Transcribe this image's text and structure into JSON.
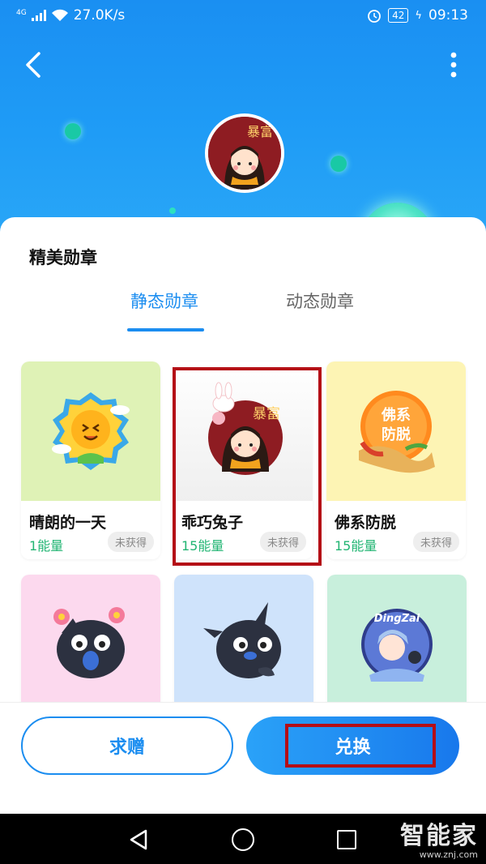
{
  "status_bar": {
    "network": "4G",
    "speed": "27.0K/s",
    "battery": "42",
    "time": "09:13"
  },
  "page": {
    "section_title": "精美勋章",
    "tabs": [
      {
        "label": "静态勋章",
        "active": true
      },
      {
        "label": "动态勋章",
        "active": false
      }
    ]
  },
  "medals": [
    {
      "name": "晴朗的一天",
      "energy": "1能量",
      "status": "未获得",
      "icon": "sunflower-badge-icon",
      "bg": "#dff2b6"
    },
    {
      "name": "乖巧兔子",
      "energy": "15能量",
      "status": "未获得",
      "icon": "rabbit-girl-badge-icon",
      "bg": "#f4f4f4"
    },
    {
      "name": "佛系防脱",
      "energy": "15能量",
      "status": "未获得",
      "icon": "ginger-badge-icon",
      "bg": "#fdf4b4"
    },
    {
      "name": "",
      "energy": "",
      "status": "",
      "icon": "crow-flowers-badge-icon",
      "bg": "#fcd9ee"
    },
    {
      "name": "",
      "energy": "",
      "status": "",
      "icon": "crow-badge-icon",
      "bg": "#cfe3fb"
    },
    {
      "name": "",
      "energy": "",
      "status": "",
      "icon": "dingzai-badge-icon",
      "bg": "#c8efdc"
    }
  ],
  "avatar_text": "暴富",
  "medal_art_text": {
    "rabbit_girl": "暴富",
    "ginger": "佛系防脱",
    "dingzai": "DingZai"
  },
  "actions": {
    "gift_label": "求赠",
    "exchange_label": "兑换"
  },
  "watermark": {
    "brand": "智能家",
    "url": "www.znj.com"
  },
  "colors": {
    "accent": "#1b8df0",
    "energy": "#22b573",
    "highlight": "#b40e16"
  }
}
